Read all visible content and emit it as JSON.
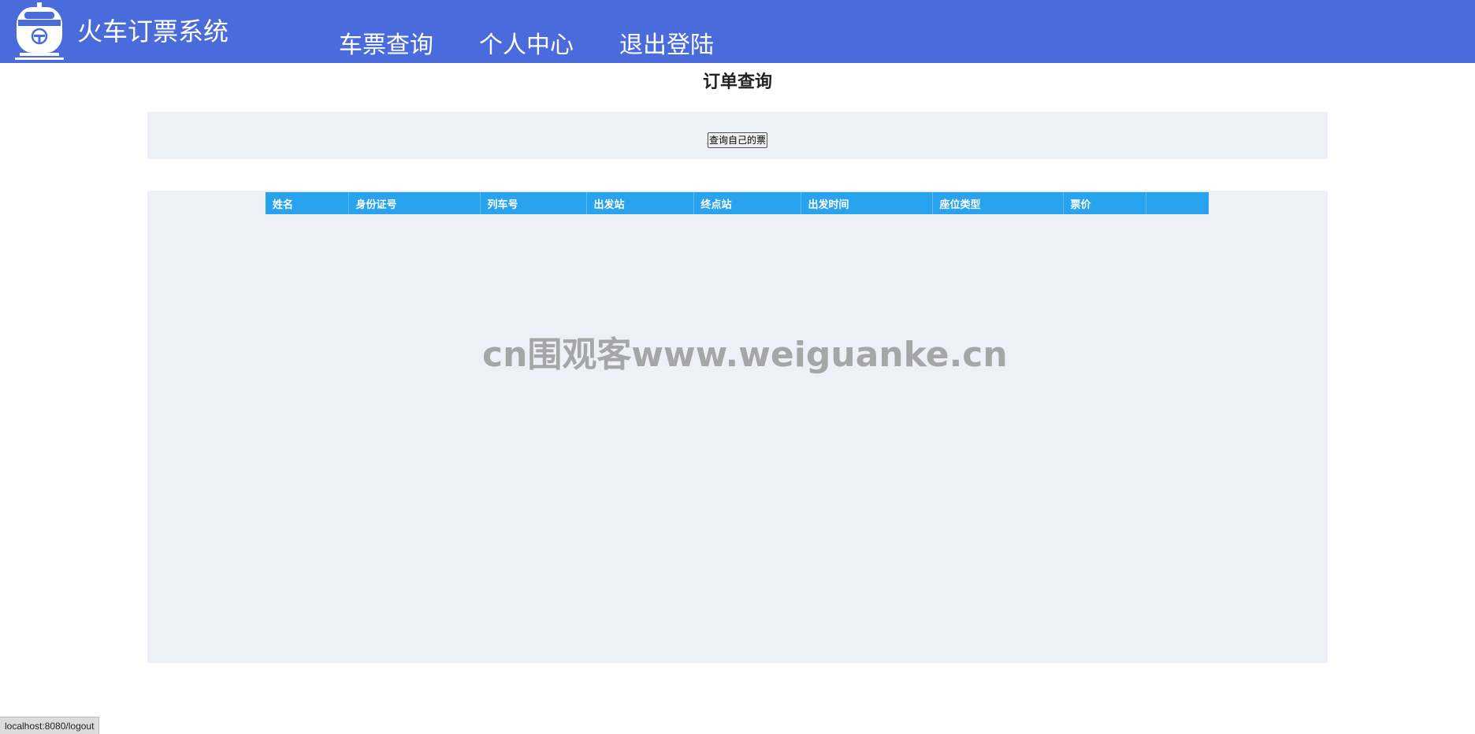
{
  "header": {
    "app_title": "火车订票系统",
    "logo_icon": "train-front-icon",
    "nav": [
      {
        "label": "车票查询"
      },
      {
        "label": "个人中心"
      },
      {
        "label": "退出登陆"
      }
    ],
    "colors": {
      "bar": "#4a6bdc"
    }
  },
  "main": {
    "title": "订单查询",
    "query_button": "查询自己的票",
    "table": {
      "columns": [
        "姓名",
        "身份证号",
        "列车号",
        "出发站",
        "终点站",
        "出发时间",
        "座位类型",
        "票价",
        ""
      ],
      "rows": [],
      "header_color": "#2aa3ef"
    }
  },
  "watermark": "cn围观客www.weiguanke.cn",
  "status_bar": {
    "url": "localhost:8080/logout"
  }
}
